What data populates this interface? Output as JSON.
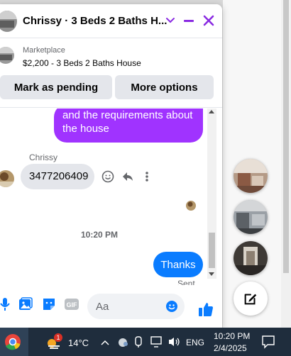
{
  "chat": {
    "title": "Chrissy · 3 Beds 2 Baths H...",
    "listing": {
      "label": "Marketplace",
      "title": "$2,200 - 3 Beds 2 Baths House",
      "mark_pending": "Mark as pending",
      "more_options": "More options"
    },
    "messages": {
      "outgoing_partial": [
        "and the requirements about",
        "the house"
      ],
      "sender_name": "Chrissy",
      "incoming_text": "3477206409",
      "timestamp": "10:20 PM",
      "outgoing_last": "Thanks",
      "status": "Sent"
    },
    "composer": {
      "placeholder": "Aa"
    }
  },
  "taskbar": {
    "temperature": "14°C",
    "weather_badge": "1",
    "language": "ENG",
    "time": "10:20 PM",
    "date": "2/4/2025"
  },
  "colors": {
    "messenger_blue": "#0a7cff",
    "messenger_purple": "#a033ff",
    "accent_magenta": "#8a2be2",
    "taskbar_bg": "#1f2d3d"
  },
  "icons": [
    "close-icon",
    "minimize-icon",
    "chevron-down-icon",
    "emoji-icon",
    "reply-icon",
    "more-icon",
    "mic-icon",
    "photo-icon",
    "sticker-icon",
    "gif-icon",
    "like-icon",
    "compose-icon",
    "chrome-icon",
    "weather-icon",
    "wifi-icon",
    "volume-icon",
    "notification-icon"
  ]
}
